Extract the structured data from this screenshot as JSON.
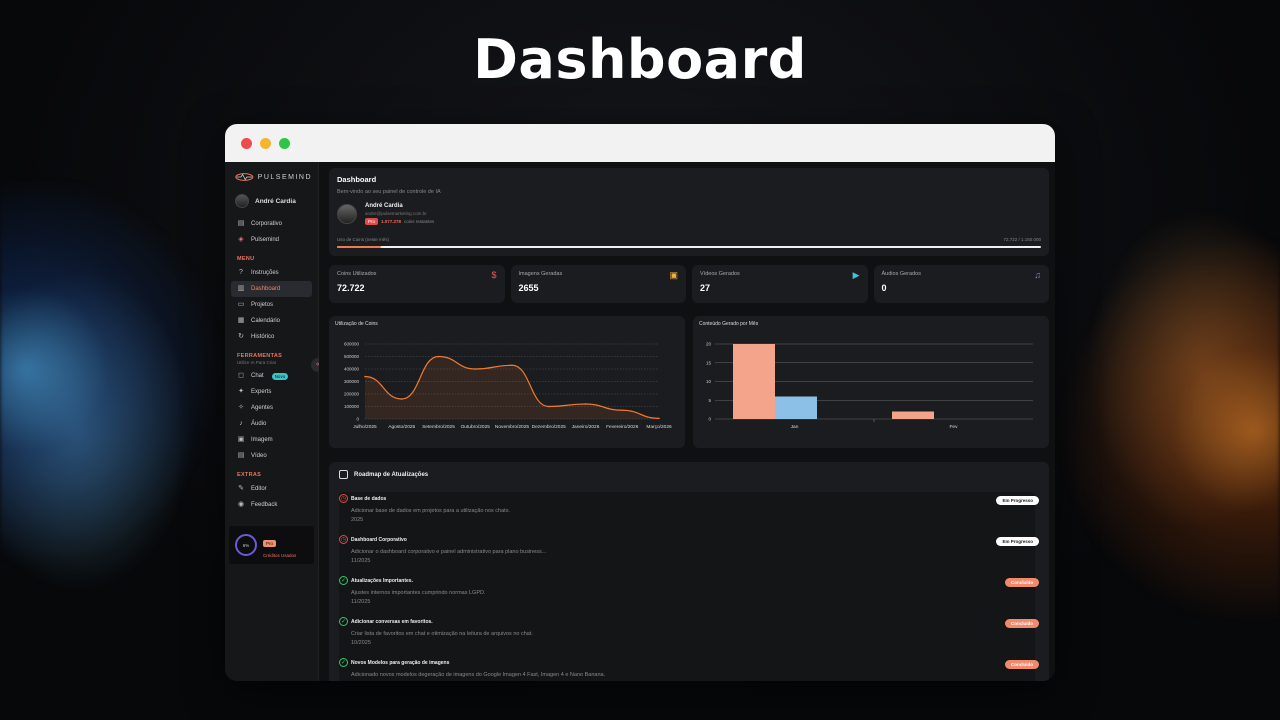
{
  "hero": {
    "title": "Dashboard"
  },
  "sidebar": {
    "brand": "PULSEMIND",
    "user_name": "André Cardia",
    "workspaces": [
      {
        "label": "Corporativo",
        "icon": "building-icon"
      },
      {
        "label": "Pulsemind",
        "icon": "cube-icon"
      }
    ],
    "menu_label": "MENU",
    "menu": [
      {
        "label": "Instruções",
        "icon": "help-icon",
        "active": false
      },
      {
        "label": "Dashboard",
        "icon": "bar-chart-icon",
        "active": true
      },
      {
        "label": "Projetos",
        "icon": "folder-icon",
        "active": false
      },
      {
        "label": "Calendário",
        "icon": "calendar-icon",
        "active": false
      },
      {
        "label": "Histórico",
        "icon": "history-icon",
        "active": false
      }
    ],
    "tools_label": "FERRAMENTAS",
    "tools_sub": "Utilize IA Para Criar",
    "tools": [
      {
        "label": "Chat",
        "icon": "chat-icon",
        "badge": "Novo"
      },
      {
        "label": "Experts",
        "icon": "sparkle-icon"
      },
      {
        "label": "Agentes",
        "icon": "robot-icon"
      },
      {
        "label": "Áudio",
        "icon": "audio-icon"
      },
      {
        "label": "Imagem",
        "icon": "image-icon"
      },
      {
        "label": "Vídeo",
        "icon": "video-icon"
      }
    ],
    "extras_label": "EXTRAS",
    "extras": [
      {
        "label": "Editor",
        "icon": "edit-icon"
      },
      {
        "label": "Feedback",
        "icon": "feedback-icon"
      }
    ],
    "credits": {
      "percent": "6%",
      "plan": "Pro",
      "label": "Créditos Usados"
    }
  },
  "header": {
    "title": "Dashboard",
    "subtitle": "Bem-vindo ao seu painel de controle de IA",
    "user_name": "André Cardia",
    "email": "andre@pulsemarketing.com.br",
    "plan": "Pro",
    "coins": "1.077.278",
    "coins_suffix": "coins restantes",
    "usage_label": "Uso de Coins (neste mês)",
    "usage_value": "72.722 / 1.150.000",
    "usage_fraction": 0.063
  },
  "stats": [
    {
      "label": "Coins Utilizados",
      "value": "72.722",
      "icon": "dollar-icon",
      "icon_color": "#f05a5a",
      "glyph": "$"
    },
    {
      "label": "Imagens Geradas",
      "value": "2655",
      "icon": "image-icon",
      "icon_color": "#f0b040",
      "glyph": "▣"
    },
    {
      "label": "Vídeos Gerados",
      "value": "27",
      "icon": "video-icon",
      "icon_color": "#3bc5d6",
      "glyph": "▶"
    },
    {
      "label": "Áudios Gerados",
      "value": "0",
      "icon": "music-icon",
      "icon_color": "#8a7ef0",
      "glyph": "♫"
    }
  ],
  "chart_data": [
    {
      "type": "line",
      "title": "Utilização de Coins",
      "categories": [
        "Julho/2025",
        "Agosto/2025",
        "Setembro/2025",
        "Outubro/2025",
        "Novembro/2025",
        "Dezembro/2025",
        "Janeiro/2026",
        "Fevereiro/2026",
        "Março/2026"
      ],
      "values": [
        340000,
        160000,
        500000,
        400000,
        430000,
        100000,
        120000,
        70000,
        5000
      ],
      "ylim": [
        0,
        600000
      ],
      "yticks": [
        "0",
        "100000",
        "200000",
        "300000",
        "400000",
        "500000",
        "600000"
      ],
      "color": "#f07a30",
      "grid": true
    },
    {
      "type": "bar",
      "title": "Conteúdo Gerado por Mês",
      "categories": [
        "Jan",
        "Fev"
      ],
      "series": [
        {
          "color": "#f4a48a",
          "values": [
            20,
            2
          ]
        },
        {
          "color": "#8cc0e6",
          "values": [
            6,
            0
          ]
        }
      ],
      "ylim": [
        0,
        20
      ],
      "yticks": [
        "0",
        "5",
        "10",
        "15",
        "20"
      ],
      "grid": true
    }
  ],
  "roadmap": {
    "title": "Roadmap de Atualizações",
    "items": [
      {
        "title": "Base de dados",
        "desc": "Adicionar base de dados em projetos para a utilização nos chats.",
        "date": "2025",
        "status": "Em Progresso",
        "state": "progress"
      },
      {
        "title": "Dashboard Corporativo",
        "desc": "Adicionar o dashboard corporativo e painel administrativo para plano business...",
        "date": "11/2025",
        "status": "Em Progresso",
        "state": "progress"
      },
      {
        "title": "Atualizações Importantes.",
        "desc": "Ajustes internos importantes cumprindo normas LGPD.",
        "date": "11/2025",
        "status": "Concluído",
        "state": "done"
      },
      {
        "title": "Adicionar conversas em favoritos.",
        "desc": "Criar lista de favoritos em chat e otimização na leitura de arquivos no chat.",
        "date": "10/2025",
        "status": "Concluído",
        "state": "done"
      },
      {
        "title": "Novos Modelos para geração de imagens",
        "desc": "Adicionado novos modelos degeração de imagens do Google Imagen 4 Fast, Imagen 4 e Nano Banana.",
        "date": "",
        "status": "Concluído",
        "state": "done"
      }
    ]
  }
}
